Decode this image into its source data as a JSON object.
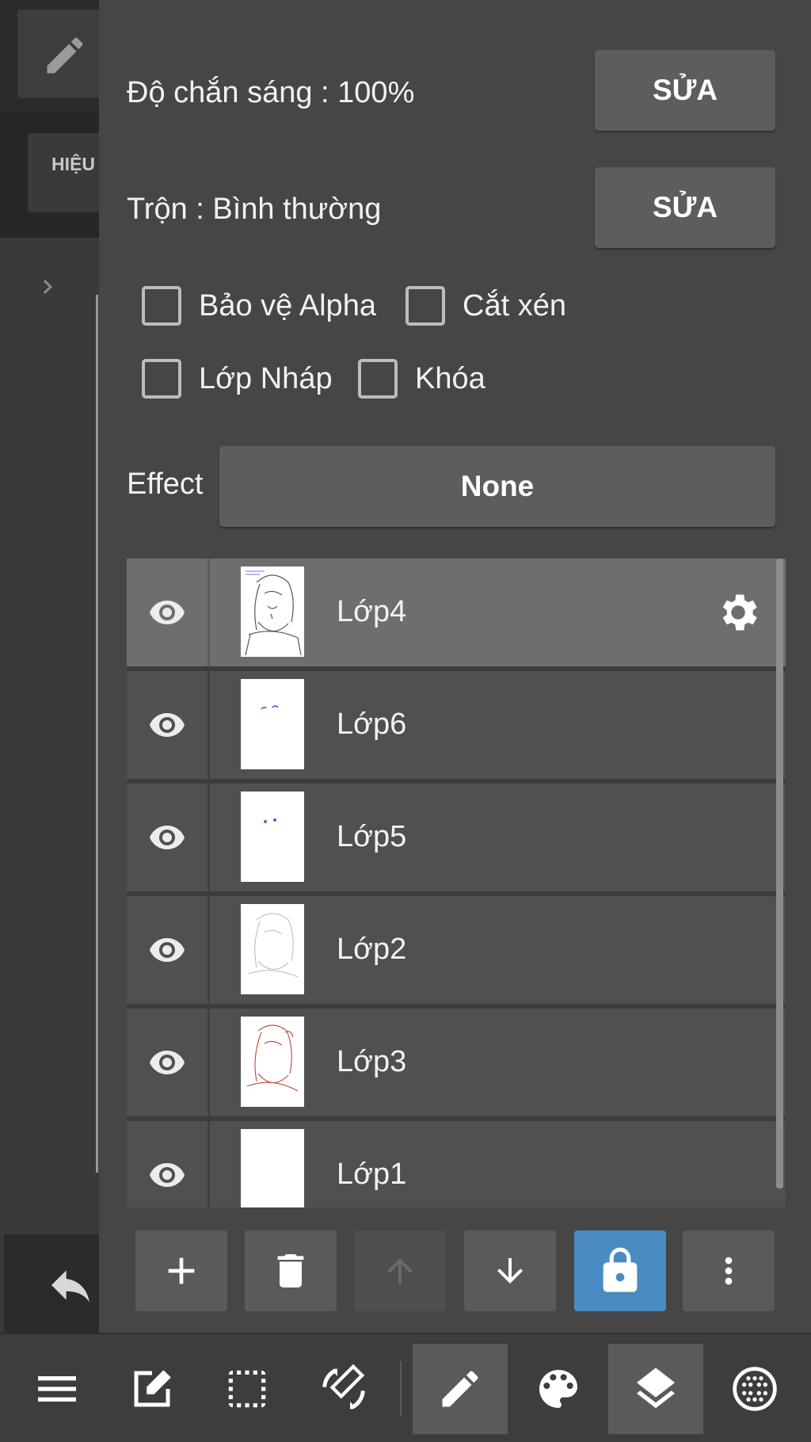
{
  "sidebar": {
    "effect_tab_label": "HIỆU"
  },
  "properties": {
    "opacity_label": "Độ chắn sáng : 100%",
    "blend_label": "Trộn : Bình thường",
    "edit_label": "SỬA"
  },
  "options": {
    "protect_alpha": "Bảo vệ Alpha",
    "clipping": "Cắt xén",
    "draft_layer": "Lớp Nháp",
    "lock": "Khóa"
  },
  "effect": {
    "label": "Effect",
    "value": "None"
  },
  "layers": [
    {
      "name": "Lớp4",
      "selected": true,
      "thumb": "lineart-black"
    },
    {
      "name": "Lớp6",
      "selected": false,
      "thumb": "blue-marks"
    },
    {
      "name": "Lớp5",
      "selected": false,
      "thumb": "blue-dots"
    },
    {
      "name": "Lớp2",
      "selected": false,
      "thumb": "lineart-light"
    },
    {
      "name": "Lớp3",
      "selected": false,
      "thumb": "lineart-red"
    },
    {
      "name": "Lớp1",
      "selected": false,
      "thumb": "blank"
    }
  ],
  "layer_actions": [
    "add-icon",
    "trash-icon",
    "arrow-up-icon",
    "arrow-down-icon",
    "lock-icon",
    "more-vertical-icon"
  ],
  "toolbar": [
    "menu-icon",
    "edit-canvas-icon",
    "selection-icon",
    "rotate-icon",
    "pen-icon",
    "palette-icon",
    "layers-icon",
    "grid-circle-icon"
  ],
  "colors": {
    "accent": "#4a8bc2",
    "panel": "#464646",
    "button": "#5d5d5d"
  }
}
